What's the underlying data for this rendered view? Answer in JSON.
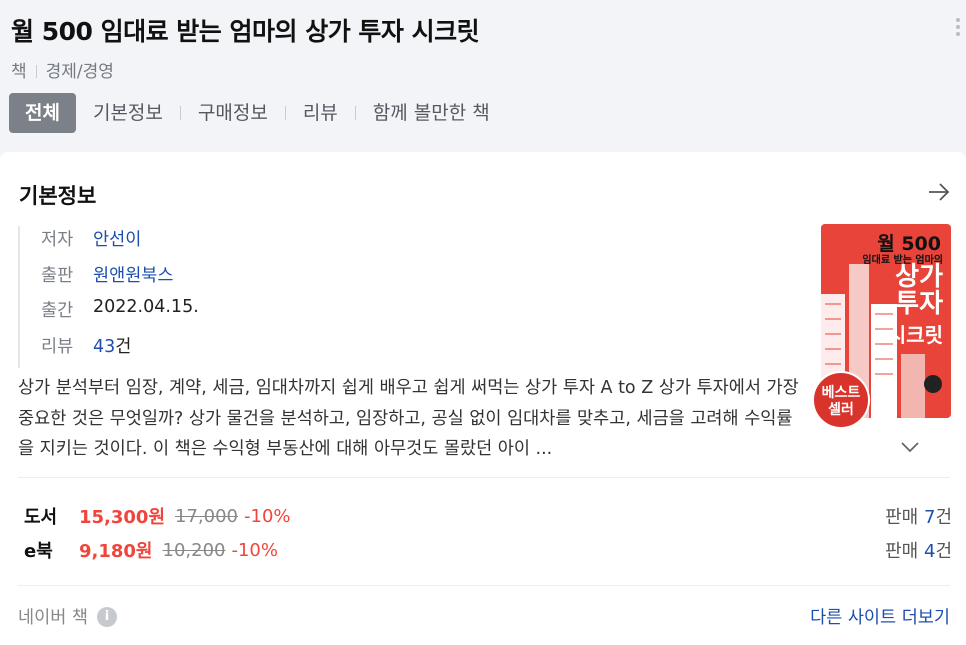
{
  "book": {
    "title": "월 500 임대료 받는 엄마의 상가 투자 시크릿",
    "category_type": "책",
    "category": "경제/경영"
  },
  "tabs": [
    {
      "label": "전체",
      "active": true
    },
    {
      "label": "기본정보"
    },
    {
      "label": "구매정보"
    },
    {
      "label": "리뷰"
    },
    {
      "label": "함께 볼만한 책"
    }
  ],
  "basic_info": {
    "section_title": "기본정보",
    "author_label": "저자",
    "author": "안선이",
    "publisher_label": "출판",
    "publisher": "원앤원북스",
    "date_label": "출간",
    "date": "2022.04.15.",
    "review_label": "리뷰",
    "review_count": "43",
    "review_unit": "건"
  },
  "cover": {
    "line1": "월 500",
    "line2": "임대료 받는 엄마의",
    "line3a": "상가",
    "line3b": "투자",
    "line4": "시크릿",
    "badge_line1": "베스트",
    "badge_line2": "셀러",
    "accent": "#e8443a"
  },
  "description": "상가 분석부터 임장, 계약, 세금, 임대차까지 쉽게 배우고 쉽게 써먹는 상가 투자 A to Z 상가 투자에서 가장 중요한 것은 무엇일까? 상가 물건을 분석하고, 임장하고, 공실 없이 임대차를 맞추고, 세금을 고려해 수익률을 지키는 것이다. 이 책은 수익형 부동산에 대해 아무것도 몰랐던 아이 ...",
  "prices": [
    {
      "type": "도서",
      "sale": "15,300원",
      "original": "17,000",
      "discount": "-10%",
      "sell_label": "판매",
      "sell_count": "7",
      "sell_unit": "건"
    },
    {
      "type": "e북",
      "sale": "9,180원",
      "original": "10,200",
      "discount": "-10%",
      "sell_label": "판매",
      "sell_count": "4",
      "sell_unit": "건"
    }
  ],
  "footer": {
    "source": "네이버 책",
    "more_link": "다른 사이트 더보기"
  }
}
